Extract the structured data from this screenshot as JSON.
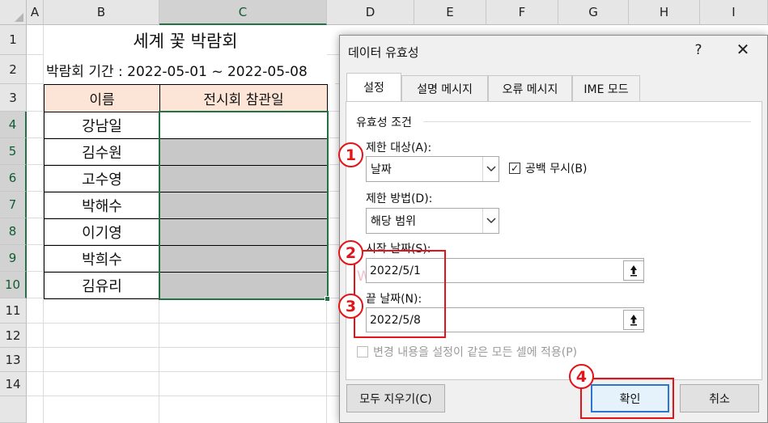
{
  "sheet": {
    "columns": [
      "A",
      "B",
      "C",
      "D",
      "E",
      "F",
      "G",
      "H",
      "I"
    ],
    "rows": [
      "1",
      "2",
      "3",
      "4",
      "5",
      "6",
      "7",
      "8",
      "9",
      "10",
      "11",
      "12",
      "13",
      "14"
    ],
    "title": "세계 꽃 박람회",
    "period": "박람회 기간 : 2022-05-01 ~ 2022-05-08",
    "header_name": "이름",
    "header_date": "전시회 참관일",
    "names": [
      "강남일",
      "김수원",
      "고수영",
      "박해수",
      "이기영",
      "박희수",
      "김유리"
    ]
  },
  "dialog": {
    "title": "데이터 유효성",
    "help": "?",
    "close": "✕",
    "tabs": [
      "설정",
      "설명 메시지",
      "오류 메시지",
      "IME 모드"
    ],
    "section_title": "유효성 조건",
    "allow_label": "제한 대상(A):",
    "allow_value": "날짜",
    "ignore_blank_label": "공백 무시(B)",
    "ignore_blank_checked": true,
    "data_label": "제한 방법(D):",
    "data_value": "해당 범위",
    "start_label": "시작 날짜(S):",
    "start_value": "2022/5/1",
    "end_label": "끝 날짜(N):",
    "end_value": "2022/5/8",
    "apply_all_label": "변경 내용을 설정이 같은 모든 셀에 적용(P)",
    "clear_all": "모두 지우기(C)",
    "ok": "확인",
    "cancel": "취소",
    "watermark": "WITHN"
  },
  "annotations": {
    "badges": [
      "1",
      "2",
      "3",
      "4"
    ],
    "color": "#e2141a"
  }
}
